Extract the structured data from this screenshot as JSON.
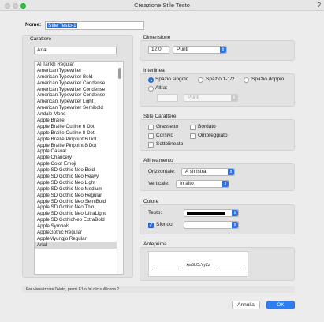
{
  "window": {
    "title": "Creazione Stile Testo",
    "help": "?"
  },
  "name": {
    "label": "Nome:",
    "value": "Stile Testo-1"
  },
  "fonts": {
    "title": "Carattere",
    "search_value": "Arial",
    "items": [
      "Al Tarikh Regular",
      "American Typewriter",
      "American Typewriter Bold",
      "American Typewriter Condense",
      "American Typewriter Condense",
      "American Typewriter Condense",
      "American Typewriter Light",
      "American Typewriter Semibold",
      "Andale Mono",
      "Apple Braille",
      "Apple Braille Outline 6 Dot",
      "Apple Braille Outline 8 Dot",
      "Apple Braille Pinpoint 6 Dot",
      "Apple Braille Pinpoint 8 Dot",
      "Apple Casual",
      "Apple Chancery",
      "Apple Color Emoji",
      "Apple SD Gothic Neo Bold",
      "Apple SD Gothic Neo Heavy",
      "Apple SD Gothic Neo Light",
      "Apple SD Gothic Neo Medium",
      "Apple SD Gothic Neo Regular",
      "Apple SD Gothic Neo SemiBold",
      "Apple SD Gothic Neo Thin",
      "Apple SD Gothic Neo UltraLight",
      "Apple SD GothicNeo ExtraBold",
      "Apple Symbols",
      "AppleGothic Regular",
      "AppleMyungjo Regular",
      "Arial"
    ],
    "selected_index": 29
  },
  "size": {
    "title": "Dimensione",
    "value": "12,0",
    "unit": "Punti"
  },
  "spacing": {
    "title": "Interlinea",
    "options": [
      "Spazio singolo",
      "Spazio 1-1/2",
      "Spazio doppio",
      "Altra:"
    ],
    "selected": "Spazio singolo",
    "other_unit": "Punti"
  },
  "style": {
    "title": "Stile Carattere",
    "options": [
      "Grassetto",
      "Bordato",
      "Corsivo",
      "Ombreggiato",
      "Sottolineato"
    ]
  },
  "alignment": {
    "title": "Allineamento",
    "horizontal_label": "Orizzontale:",
    "horizontal_value": "A sinistra",
    "vertical_label": "Verticale:",
    "vertical_value": "In alto"
  },
  "color": {
    "title": "Colore",
    "text_label": "Testo:",
    "text_color": "#000000",
    "background_label": "Sfondo:",
    "background_checked": true,
    "background_color": "#ffffff"
  },
  "preview": {
    "title": "Anteprima",
    "sample": "AaBbCcYyZz"
  },
  "status": "Per visualizzare l'Aiuto, premi F1 o fai clic sull'icona ?",
  "buttons": {
    "cancel": "Annulla",
    "ok": "OK"
  },
  "accent": "#2f73e0"
}
